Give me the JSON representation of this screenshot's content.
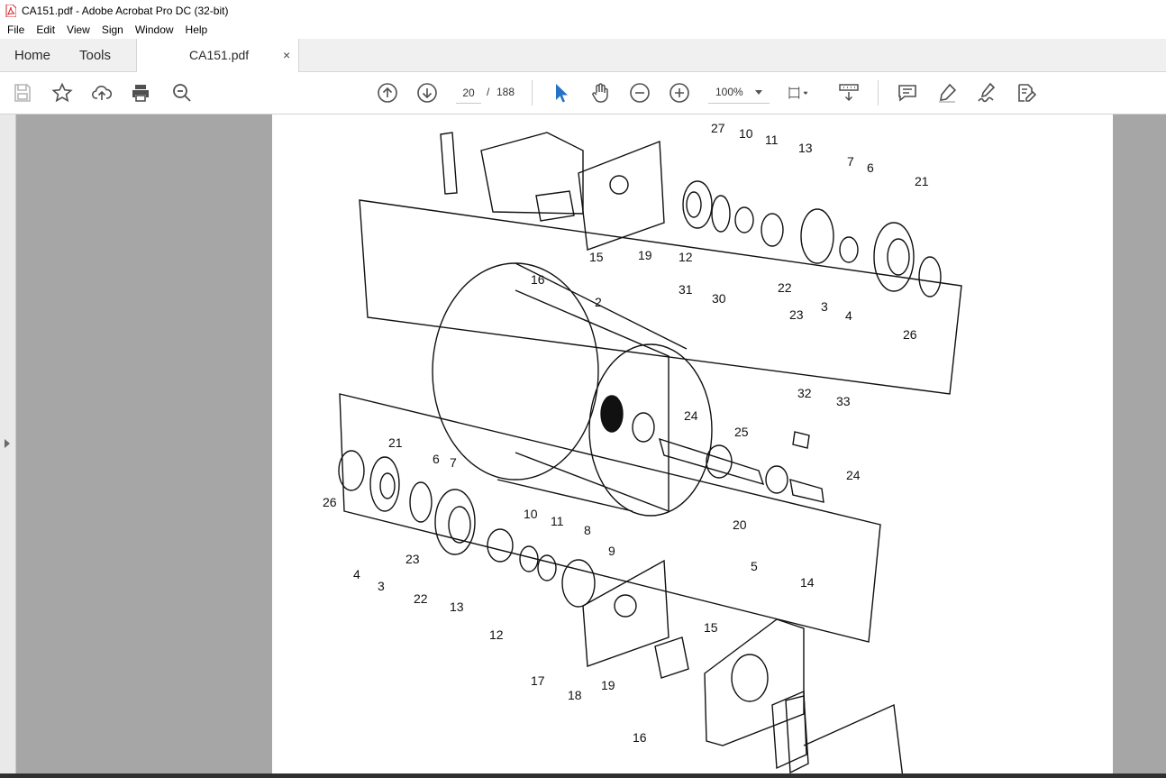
{
  "window": {
    "title": "CA151.pdf - Adobe Acrobat Pro DC (32-bit)"
  },
  "menu": [
    "File",
    "Edit",
    "View",
    "Sign",
    "Window",
    "Help"
  ],
  "tabs": {
    "home": "Home",
    "tools": "Tools",
    "document": "CA151.pdf",
    "close": "×"
  },
  "toolbar": {
    "page_current": "20",
    "page_sep": "/",
    "page_total": "188",
    "zoom": "100%",
    "icons": [
      "save-icon",
      "star-icon",
      "upload-icon",
      "print-icon",
      "search-zoom-icon",
      "page-up-icon",
      "page-down-icon",
      "select-cursor-icon",
      "hand-icon",
      "zoom-out-icon",
      "zoom-in-icon",
      "fit-page-icon",
      "scroll-mode-icon",
      "comment-icon",
      "highlight-icon",
      "sign-icon",
      "edit-pdf-icon"
    ]
  },
  "document": {
    "callouts": {
      "c27": "27",
      "c10a": "10",
      "c11a": "11",
      "c13a": "13",
      "c7a": "7",
      "c6a": "6",
      "c21a": "21",
      "c15a": "15",
      "c19a": "19",
      "c12a": "12",
      "c16a": "16",
      "c22a": "22",
      "c23a": "23",
      "c3a": "3",
      "c4a": "4",
      "c26a": "26",
      "c2": "2",
      "c31": "31",
      "c30": "30",
      "c32": "32",
      "c33": "33",
      "c24a": "24",
      "c25": "25",
      "c24b": "24",
      "c20": "20",
      "c21b": "21",
      "c6b": "6",
      "c7b": "7",
      "c26b": "26",
      "c10b": "10",
      "c11b": "11",
      "c8": "8",
      "c9": "9",
      "c4b": "4",
      "c3b": "3",
      "c23b": "23",
      "c22b": "22",
      "c13b": "13",
      "c12b": "12",
      "c5": "5",
      "c14": "14",
      "c15b": "15",
      "c17": "17",
      "c18": "18",
      "c19b": "19",
      "c16b": "16"
    }
  }
}
